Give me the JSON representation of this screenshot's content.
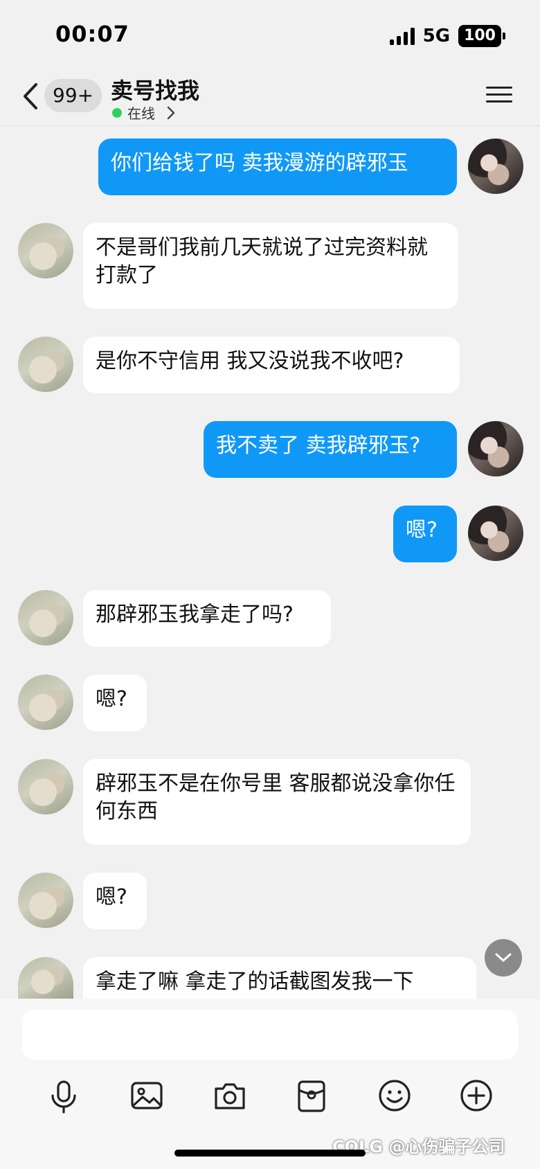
{
  "status_bar": {
    "time": "00:07",
    "network": "5G",
    "battery": "100"
  },
  "header": {
    "unread_badge": "99+",
    "title": "卖号找我",
    "status": "在线"
  },
  "messages": [
    {
      "side": "out",
      "text": "你们给钱了吗 卖我漫游的辟邪玉"
    },
    {
      "side": "in",
      "text": "不是哥们我前几天就说了过完资料就打款了"
    },
    {
      "side": "in",
      "text": "是你不守信用  我又没说我不收吧?"
    },
    {
      "side": "out",
      "text": "我不卖了 卖我辟邪玉?"
    },
    {
      "side": "out",
      "text": "嗯?"
    },
    {
      "side": "in",
      "text": "那辟邪玉我拿走了吗?"
    },
    {
      "side": "in",
      "text": "嗯?"
    },
    {
      "side": "in",
      "text": "辟邪玉不是在你号里  客服都说没拿你任何东西"
    },
    {
      "side": "in",
      "text": "嗯?"
    },
    {
      "side": "in",
      "text": "拿走了嘛  拿走了的话截图发我一下"
    }
  ],
  "input": {
    "value": "",
    "placeholder": ""
  },
  "toolbar": [
    "microphone-icon",
    "image-icon",
    "camera-icon",
    "red-packet-icon",
    "emoji-icon",
    "plus-icon"
  ],
  "watermark": "COLG @心伤骗子公司",
  "colors": {
    "outgoing_bubble": "#1098f7",
    "incoming_bubble": "#ffffff",
    "background": "#f1f1f1",
    "online": "#2fd15b"
  }
}
